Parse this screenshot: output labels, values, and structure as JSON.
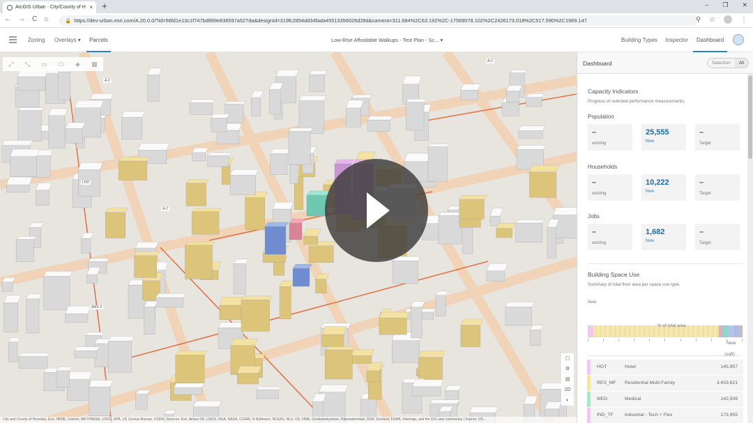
{
  "browser": {
    "tab_title": "ArcGIS Urban - City/County of H",
    "tab_close": "×",
    "new_tab": "+",
    "url": "https://dev-urban.esri.com/A.20.0.0/?id=56fd1e13c1f747bd899e836597a527da&designId=319fc2854dd34fada45513356026d28d&camera=311.684%2C63.192%2C-17569078.102%2C2426173.018%2C517.590%2C1969.147",
    "back": "←",
    "forward": "→",
    "reload": "C",
    "home": "⌂",
    "lock": "🔒",
    "zoom": "⚲",
    "star": "☆",
    "menu": "⋮",
    "minimize": "–",
    "maximize": "❐",
    "close": "✕"
  },
  "header": {
    "tabs": [
      {
        "label": "Zoning"
      },
      {
        "label": "Overlays ▾"
      },
      {
        "label": "Parcels"
      }
    ],
    "scenario": "Low-Rise Affordable Walkups - Test Plan - Sc...  ▾",
    "right_tabs": [
      {
        "label": "Building Types"
      },
      {
        "label": "Inspector"
      },
      {
        "label": "Dashboard"
      }
    ]
  },
  "map": {
    "labels": [
      {
        "text": "A-2"
      },
      {
        "text": "LHD"
      },
      {
        "text": "A-2"
      },
      {
        "text": "AMX-2"
      },
      {
        "text": "A-2"
      }
    ],
    "tools": [
      "⤢",
      "⤡",
      "▭",
      "⬭",
      "◈",
      "▦"
    ],
    "scene_tools": [
      "▢",
      "⚙",
      "▤",
      "2D",
      "◐"
    ],
    "attribution": "City and County of Honolulu, Esri, HERE, Garmin, METI/NASA, USGS, EPA, US Census Bureau, USDA | Sources: Esri, Airbus DS, USGS, NGA, NASA, CGIAR, N Robinson, NCEAS, NLS, OS, NMA, Geodatastyrelsen, Rijkswaterstaat, GSA, Geoland, FEMA, Intermap, and the GIS user community | Source: US..."
  },
  "dashboard": {
    "title": "Dashboard",
    "seg_selection": "Selection",
    "seg_all": "All",
    "capacity_title": "Capacity Indicators",
    "capacity_sub": "Progress of selected performance measurements.",
    "metrics": [
      {
        "label": "Population",
        "existing": "–",
        "existing_label": "existing",
        "new": "25,555",
        "new_label": "New",
        "target": "–",
        "target_label": "Target"
      },
      {
        "label": "Households",
        "existing": "–",
        "existing_label": "existing",
        "new": "10,222",
        "new_label": "New",
        "target": "–",
        "target_label": "Target"
      },
      {
        "label": "Jobs",
        "existing": "–",
        "existing_label": "existing",
        "new": "1,682",
        "new_label": "New",
        "target": "–",
        "target_label": "Target"
      }
    ],
    "space_title": "Building Space Use",
    "space_sub": "Summary of total floor area per space use type.",
    "bar_label": "New",
    "bar_axis": "% of total area",
    "table_new": "New",
    "table_unit": "(sqft)",
    "rows": [
      {
        "code": "HOT",
        "name": "Hotel",
        "area": "145,957",
        "color": "#f4c9f0"
      },
      {
        "code": "RES_MF",
        "name": "Residential Multi-Family",
        "area": "3,403,621",
        "color": "#f5e6a4"
      },
      {
        "code": "MED",
        "name": "Medical",
        "area": "142,508",
        "color": "#aee7c8"
      },
      {
        "code": "IND_TF",
        "name": "Industrial - Tech + Flex",
        "area": "173,955",
        "color": "#f0c8e8"
      }
    ]
  }
}
